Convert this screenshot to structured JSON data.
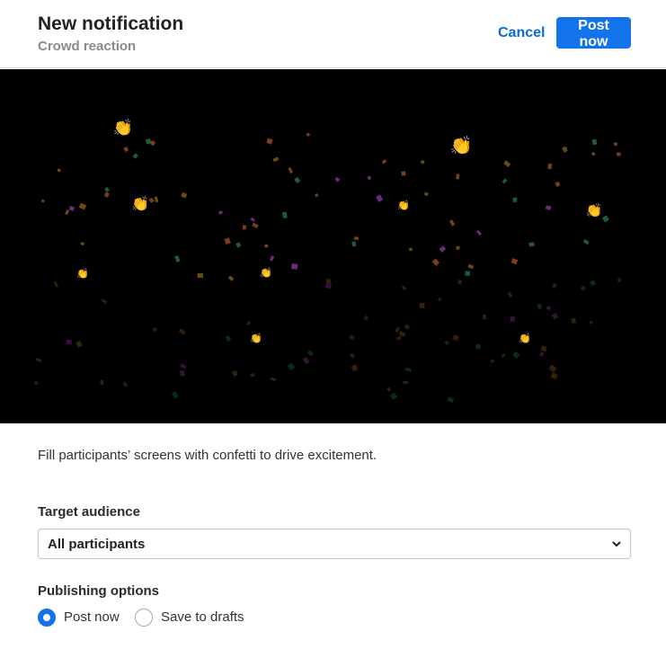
{
  "header": {
    "title": "New notification",
    "subtitle": "Crowd reaction",
    "cancel_label": "Cancel",
    "post_label": "Post now"
  },
  "preview": {
    "background": "#000000",
    "confetti_colors": [
      "#7a3d1a",
      "#6a2b7a",
      "#1d5a3e",
      "#6b4a12"
    ],
    "emoji": "👏",
    "emoji_name": "clapping-hands-icon"
  },
  "description": "Fill participants’ screens with confetti to drive excitement.",
  "target_audience": {
    "label": "Target audience",
    "selected": "All participants"
  },
  "publishing": {
    "label": "Publishing options",
    "options": [
      {
        "label": "Post now",
        "checked": true
      },
      {
        "label": "Save to drafts",
        "checked": false
      }
    ]
  },
  "colors": {
    "accent": "#1273eb",
    "link": "#0a6ad6"
  }
}
